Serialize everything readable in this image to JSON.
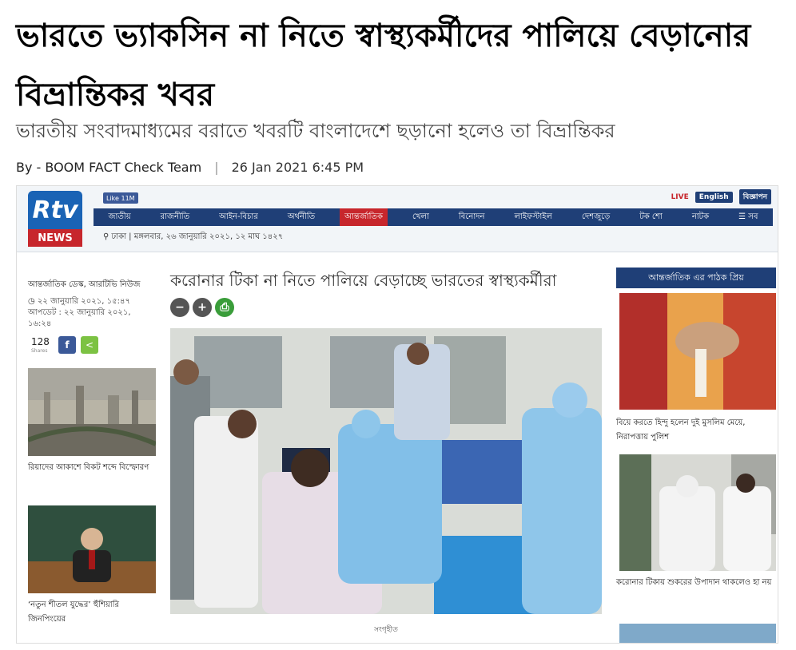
{
  "article": {
    "headline": "ভারতে ভ্যাকসিন না নিতে স্বাস্থ্যকর্মীদের পালিয়ে বেড়ানোর বিভ্রান্তিকর খবর",
    "subheadline": "ভারতীয় সংবাদমাধ্যমের বরাতে খবরটি বাংলাদেশে ছড়ানো হলেও তা বিভ্রান্তিকর",
    "byline": "By - BOOM FACT Check Team",
    "separator": "|",
    "date": "26 Jan 2021 6:45 PM"
  },
  "screenshot": {
    "logo_text": "Rtv",
    "logo_sub": "NEWS",
    "fb_like": "Like 11M",
    "live_label": "LIVE",
    "lang_button": "English",
    "ad_button": "বিজ্ঞাপন",
    "nav": [
      {
        "label": "জাতীয়",
        "active": false
      },
      {
        "label": "রাজনীতি",
        "active": false
      },
      {
        "label": "আইন-বিচার",
        "active": false
      },
      {
        "label": "অর্থনীতি",
        "active": false
      },
      {
        "label": "আন্তর্জাতিক",
        "active": true
      },
      {
        "label": "খেলা",
        "active": false
      },
      {
        "label": "বিনোদন",
        "active": false
      },
      {
        "label": "লাইফস্টাইল",
        "active": false
      },
      {
        "label": "দেশজুড়ে",
        "active": false
      },
      {
        "label": "টক শো",
        "active": false
      },
      {
        "label": "নাটক",
        "active": false
      },
      {
        "label": "☰ সব",
        "active": false
      }
    ],
    "dateline": "ঢাকা | মঙ্গলবার, ২৬ জানুয়ারি ২০২১, ১২ মাঘ ১৪২৭",
    "author": "আন্তর্জাতিক ডেস্ক, আরটিভি নিউজ",
    "published": "২২ জানুয়ারি ২০২১, ১৫:৪৭",
    "updated": "আপডেট : ২২ জানুয়ারি ২০২১, ১৬:২৪",
    "share_count": "128",
    "share_label": "Shares",
    "article_title": "করোনার টিকা না নিতে পালিয়ে বেড়াচ্ছে ভারতের স্বাস্থ্যকর্মীরা",
    "photo_credit": "সংগৃহীত",
    "left_items": [
      {
        "caption": "রিয়াদের আকাশে বিকট শব্দে বিস্ফোরণ"
      },
      {
        "caption": "‘নতুন শীতল যুদ্ধের’ হুঁশিয়ারি জিনপিংয়ের"
      }
    ],
    "right_header": "আন্তর্জাতিক এর পাঠক প্রিয়",
    "right_items": [
      {
        "caption": "বিয়ে করতে হিন্দু হলেন দুই মুসলিম মেয়ে, নিরাপত্তায় পুলিশ"
      },
      {
        "caption": "করোনার টিকায় শুকরের উপাদান থাকলেও হা নয়"
      }
    ],
    "colors": {
      "brand_blue": "#1f3f77",
      "brand_red": "#c7262c"
    }
  }
}
